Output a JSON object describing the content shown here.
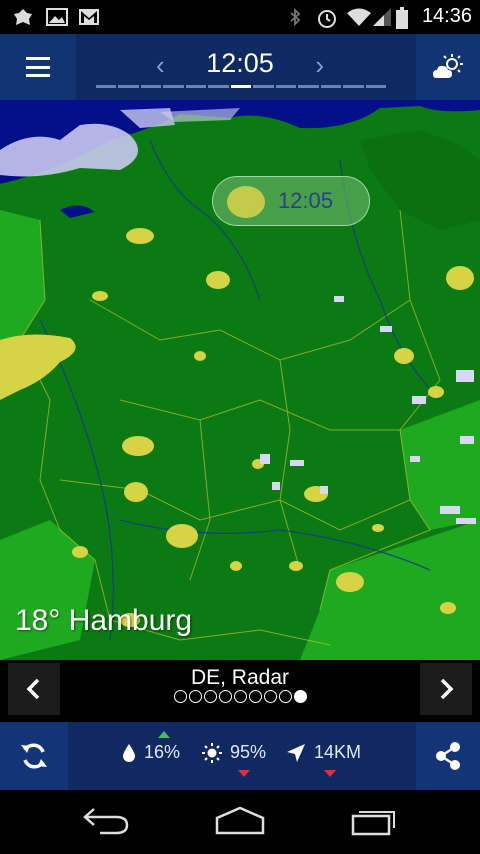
{
  "status_bar": {
    "time": "14:36",
    "icons": [
      "notification-icon",
      "gallery-icon",
      "gmail-icon",
      "bluetooth-icon",
      "alarm-icon",
      "wifi-icon",
      "signal-icon",
      "battery-icon"
    ]
  },
  "toolbar": {
    "current_time": "12:05",
    "timeline_steps": 13,
    "timeline_active_index": 6,
    "menu_icon": "hamburger-menu-icon",
    "weather_icon": "sun-cloud-icon"
  },
  "map": {
    "bubble_time": "12:05",
    "city_label": "18° Hamburg",
    "colors": {
      "sea": "#04108a",
      "land": "#0c7a12",
      "neighbor_land": "#1eaa1e",
      "rain_light": "#d6d445",
      "rain_snow": "#c8c8f0"
    }
  },
  "layer_selector": {
    "name": "DE, Radar",
    "page_count": 9,
    "active_page": 8
  },
  "info_bar": {
    "humidity": "16%",
    "sunshine": "95%",
    "wind": "14KM",
    "humidity_trend": "up",
    "sunshine_trend": "down",
    "wind_trend": "down",
    "trend_up_color": "#3fbf5e",
    "trend_down_color": "#e0323a"
  },
  "nav_bar": {
    "icons": [
      "back-icon",
      "home-icon",
      "recent-apps-icon"
    ]
  }
}
